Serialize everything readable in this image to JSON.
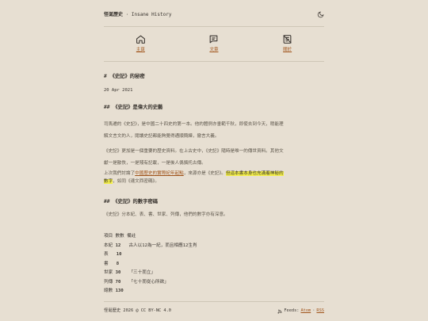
{
  "header": {
    "brand_name": "怪诞歷史",
    "brand_sep": " · ",
    "brand_tagline": "Insane History"
  },
  "nav": [
    {
      "label": "主頁",
      "icon": "home-icon"
    },
    {
      "label": "文章",
      "icon": "article-icon"
    },
    {
      "label": "關於",
      "icon": "about-icon"
    }
  ],
  "article": {
    "title": "# 《史記》的秘密",
    "date": "20 Apr 2021",
    "section1_heading": "## 《史記》是偉大的史藝",
    "p1_line1": "司馬遷的《史記》，是中國二十四史的第一本。他的體例亦垂範千秋，即使去到今天，稍能理",
    "p1_line2": "解文言文的人，閱讀史記都能夠覺得通順簡練，撤言大義。",
    "p2_line1": "《史記》更加是一個重要的歷史資料。在上古史中，《史記》隨時是唯一的傳世資料。其他文",
    "p2_line2": "獻一是散佚，一是殘有記載，一是後人僞撰托古傳。",
    "p3_pre": "上次我們討論了",
    "p3_link": "中國歷史的實際紀年起點",
    "p3_mid": "，來源亦是《史記》。",
    "p3_hl1": "但這本書本身也充滿着神秘的",
    "p3_hl2": "數字",
    "p3_post": "，如同《達文西密碼》。",
    "section2_heading": "## 《史記》的數字密碼",
    "p4": "《史記》分本紀、表、書、世家、列傳，他們的數字亦有深意。"
  },
  "table": {
    "header": "項目 數數 備註",
    "rows": [
      {
        "name": "本紀",
        "count": "12",
        "note": "古人以12為一紀，而且相應12生肖"
      },
      {
        "name": "表",
        "count": "10",
        "note": ""
      },
      {
        "name": "書",
        "count": "8",
        "note": ""
      },
      {
        "name": "世家",
        "count": "30",
        "note": "「三十而立」"
      },
      {
        "name": "列傳",
        "count": "70",
        "note": "「七十而從心所欲」"
      },
      {
        "name": "總數",
        "count": "130",
        "note": ""
      }
    ]
  },
  "footer": {
    "copyright": "怪诞歷史 2026 @ CC BY-NC 4.0",
    "feeds_label": "Feeds:",
    "atom": "Atom",
    "dot": "·",
    "rss": "RSS"
  },
  "colors": {
    "background": "#e7dfd2",
    "accent": "#a0541b",
    "highlight": "#f4ef4a"
  }
}
